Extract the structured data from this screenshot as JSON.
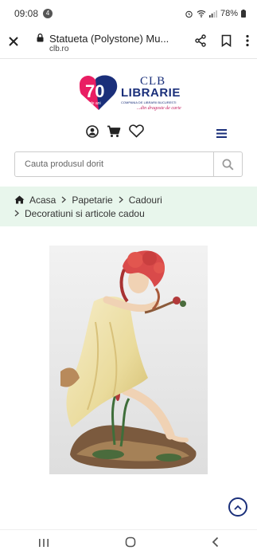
{
  "status_bar": {
    "time": "09:08",
    "notification_count": "4",
    "battery": "78%"
  },
  "browser": {
    "page_title": "Statueta (Polystone) Mu...",
    "domain": "clb.ro"
  },
  "logo": {
    "anniversary_number": "70",
    "anniversary_sub": "de ani",
    "clb": "CLB",
    "librarie": "LIBRARIE",
    "company": "COMPANIA DE LIBRARII BUCURESTI",
    "tagline": "...din dragoste de carte"
  },
  "search": {
    "placeholder": "Cauta produsul dorit"
  },
  "breadcrumb": {
    "items": [
      "Acasa",
      "Papetarie",
      "Cadouri",
      "Decoratiuni si articole cadou"
    ]
  },
  "colors": {
    "brand_blue": "#1a2f7a",
    "brand_pink": "#e91e63",
    "breadcrumb_bg": "#e8f6ec"
  }
}
